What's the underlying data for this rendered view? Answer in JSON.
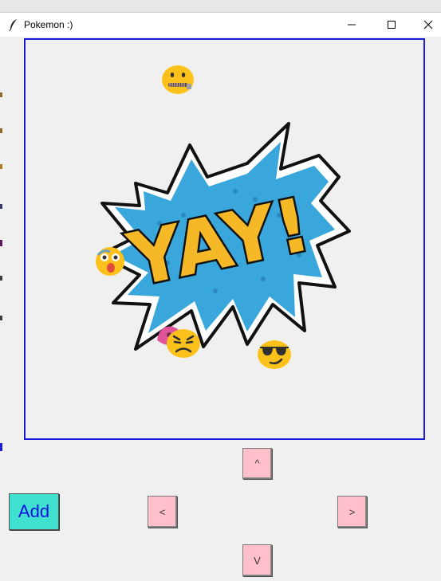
{
  "window": {
    "title": "Pokemon :)"
  },
  "canvas": {
    "image_text": "YAY!",
    "emojis": [
      "zipper-mouth-face",
      "flushed-face",
      "persevering-face",
      "sunglasses-face"
    ],
    "border_color": "#1c1cd8"
  },
  "controls": {
    "up_label": "^",
    "left_label": "<",
    "right_label": ">",
    "down_label": "V",
    "add_label": "Add"
  },
  "colors": {
    "arrow_button_bg": "#ffc0cb",
    "add_button_bg": "#40e0d0",
    "add_button_text": "#1010e0"
  }
}
